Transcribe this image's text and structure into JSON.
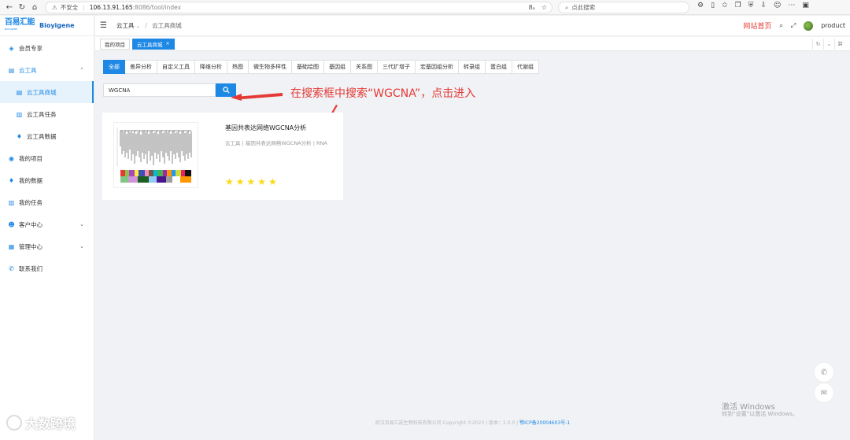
{
  "browser": {
    "insecure_label": "不安全",
    "url_host": "106.13.91.165",
    "url_path": ":8086/tool/index",
    "search_placeholder": "点此搜索",
    "text_size_label": "8ₐ"
  },
  "sidebar": {
    "logo_cn": "百易汇能",
    "logo_sub": "BIOYIGENE",
    "logo_en": "Bioyigene",
    "items": [
      {
        "label": "会员专享",
        "icon": "member-icon"
      },
      {
        "label": "云工具",
        "icon": "cloud-tool-icon"
      },
      {
        "label": "云工具商城",
        "icon": "store-icon"
      },
      {
        "label": "云工具任务",
        "icon": "task-doc-icon"
      },
      {
        "label": "云工具数据",
        "icon": "data-icon"
      },
      {
        "label": "我的项目",
        "icon": "project-icon"
      },
      {
        "label": "我的数据",
        "icon": "my-data-icon"
      },
      {
        "label": "我的任务",
        "icon": "my-task-icon"
      },
      {
        "label": "客户中心",
        "icon": "customer-icon"
      },
      {
        "label": "管理中心",
        "icon": "admin-icon"
      },
      {
        "label": "联系我们",
        "icon": "contact-icon"
      }
    ]
  },
  "header": {
    "crumb_root": "云工具",
    "crumb_current": "云工具商城",
    "home_link": "网站首页",
    "username": "product"
  },
  "tabs": {
    "items": [
      {
        "label": "我的项目"
      },
      {
        "label": "云工具商城"
      }
    ]
  },
  "filters": [
    "全部",
    "差异分析",
    "自定义工具",
    "降维分析",
    "热图",
    "微生物多样性",
    "基础绘图",
    "基因组",
    "关系图",
    "三代扩增子",
    "宏基因组分析",
    "转录组",
    "蛋白组",
    "代谢组"
  ],
  "search": {
    "value": "WGCNA"
  },
  "annotation": "在搜索框中搜索“WGCNA”，点击进入",
  "card": {
    "title": "基因共表达网络WGCNA分析",
    "meta": "云工具 | 基因共表达网络WGCNA分析 | RNA",
    "rating": 5
  },
  "footer": {
    "copyright": "武汉百易汇能生物科技有限公司 Copyright ©2023 | 版本：1.0.0 |",
    "icp": "鄂ICP备20004603号-1"
  },
  "watermark": {
    "title": "激活 Windows",
    "subtitle": "转到“设置”以激活 Windows。"
  },
  "brand_mark": "大数跨境",
  "colors": {
    "primary": "#1e88e5",
    "annotation": "#e53935",
    "star": "#fadb14"
  }
}
